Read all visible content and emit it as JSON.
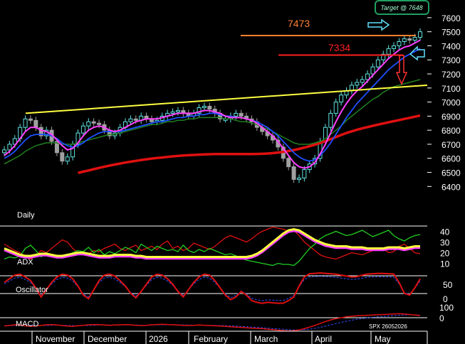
{
  "chart_data": {
    "type": "line",
    "ticker_label": "SPX 26052026",
    "target_badge": "Target @ 7648",
    "levels": [
      {
        "label": "7473",
        "value": 7473,
        "color": "#ff8030"
      },
      {
        "label": "7334",
        "value": 7334,
        "color": "#ff2020"
      }
    ],
    "price_axis": {
      "min": 6250,
      "max": 7660,
      "ticks": [
        7600,
        7500,
        7400,
        7300,
        7200,
        7100,
        7000,
        6900,
        6800,
        6700,
        6600,
        6500,
        6400
      ]
    },
    "months": [
      "November",
      "December",
      "2026",
      "February",
      "March",
      "April",
      "May"
    ],
    "panels": [
      {
        "label": "Daily"
      },
      {
        "label": "ADX",
        "ticks": [
          40,
          30,
          20,
          10
        ],
        "range": [
          5,
          45
        ]
      },
      {
        "label": "Oscillator",
        "ticks": [
          50,
          0
        ],
        "range": [
          -80,
          100
        ]
      },
      {
        "label": "MACD",
        "ticks": [
          100,
          0
        ],
        "range": [
          -60,
          150
        ]
      }
    ],
    "trendline": {
      "x": [
        36,
        600
      ],
      "y": [
        6920,
        7120
      ],
      "color": "#ffff40"
    },
    "colors": {
      "ma_fast": "#ff40ff",
      "ma_mid": "#1e50ff",
      "ma_slow": "#208020",
      "ma_long": "#e01010",
      "adx": "#ffff40",
      "di_plus": "#20d020",
      "di_minus": "#e01010",
      "adx_ma": "#ff40ff",
      "candle_up": "#60e0e0",
      "candle_down": "#a0a0a0",
      "badge": "#20a060"
    },
    "price_series": [
      6660,
      6700,
      6740,
      6820,
      6880,
      6870,
      6820,
      6760,
      6800,
      6720,
      6640,
      6580,
      6610,
      6700,
      6780,
      6830,
      6860,
      6850,
      6840,
      6800,
      6760,
      6780,
      6820,
      6860,
      6880,
      6870,
      6900,
      6880,
      6860,
      6870,
      6900,
      6920,
      6930,
      6940,
      6920,
      6900,
      6920,
      6960,
      6970,
      6950,
      6920,
      6880,
      6880,
      6900,
      6920,
      6900,
      6880,
      6860,
      6820,
      6790,
      6760,
      6730,
      6680,
      6600,
      6540,
      6450,
      6460,
      6520,
      6560,
      6600,
      6720,
      6820,
      6920,
      7000,
      7050,
      7080,
      7120,
      7140,
      7160,
      7200,
      7250,
      7300,
      7340,
      7380,
      7400,
      7430,
      7450,
      7440,
      7460,
      7500
    ],
    "ma_fast_series": [
      6620,
      6650,
      6690,
      6740,
      6790,
      6820,
      6820,
      6800,
      6790,
      6770,
      6730,
      6690,
      6660,
      6670,
      6710,
      6760,
      6800,
      6820,
      6830,
      6820,
      6800,
      6790,
      6800,
      6820,
      6840,
      6860,
      6870,
      6880,
      6880,
      6880,
      6890,
      6900,
      6910,
      6920,
      6920,
      6920,
      6920,
      6930,
      6940,
      6940,
      6930,
      6920,
      6900,
      6890,
      6890,
      6890,
      6880,
      6870,
      6850,
      6820,
      6790,
      6760,
      6720,
      6670,
      6620,
      6570,
      6540,
      6530,
      6540,
      6570,
      6630,
      6700,
      6780,
      6860,
      6930,
      6990,
      7040,
      7080,
      7110,
      7150,
      7190,
      7230,
      7270,
      7310,
      7340,
      7370,
      7390,
      7400,
      7420,
      7440
    ],
    "ma_mid_series": [
      6600,
      6620,
      6650,
      6690,
      6730,
      6760,
      6770,
      6770,
      6770,
      6760,
      6740,
      6710,
      6690,
      6680,
      6690,
      6710,
      6740,
      6760,
      6780,
      6790,
      6790,
      6790,
      6790,
      6800,
      6810,
      6820,
      6830,
      6840,
      6850,
      6860,
      6860,
      6870,
      6880,
      6890,
      6890,
      6900,
      6900,
      6910,
      6910,
      6920,
      6920,
      6910,
      6900,
      6900,
      6890,
      6890,
      6880,
      6870,
      6860,
      6840,
      6820,
      6790,
      6760,
      6720,
      6680,
      6640,
      6610,
      6590,
      6580,
      6590,
      6620,
      6660,
      6710,
      6770,
      6830,
      6890,
      6940,
      6990,
      7030,
      7070,
      7110,
      7150,
      7190,
      7230,
      7260,
      7290,
      7320,
      7340,
      7360,
      7380
    ],
    "ma_slow_series": [
      6560,
      6580,
      6600,
      6620,
      6650,
      6670,
      6690,
      6700,
      6710,
      6710,
      6710,
      6700,
      6700,
      6700,
      6710,
      6720,
      6730,
      6740,
      6750,
      6760,
      6770,
      6770,
      6780,
      6790,
      6800,
      6810,
      6820,
      6830,
      6840,
      6840,
      6850,
      6860,
      6860,
      6870,
      6870,
      6880,
      6880,
      6890,
      6890,
      6890,
      6890,
      6890,
      6880,
      6880,
      6870,
      6860,
      6860,
      6850,
      6840,
      6820,
      6810,
      6790,
      6770,
      6750,
      6730,
      6710,
      6700,
      6700,
      6700,
      6710,
      6720,
      6740,
      6770,
      6800,
      6830,
      6870,
      6900,
      6930,
      6960,
      6990,
      7020,
      7040,
      7070,
      7090,
      7110,
      7120,
      7130,
      7140,
      7150,
      7160
    ],
    "ma_long_series": [
      6340,
      6352,
      6364,
      6376,
      6388,
      6400,
      6412,
      6423,
      6434,
      6445,
      6456,
      6466,
      6476,
      6486,
      6496,
      6505,
      6514,
      6523,
      6532,
      6540,
      6548,
      6556,
      6563,
      6570,
      6576,
      6582,
      6588,
      6593,
      6598,
      6602,
      6606,
      6610,
      6614,
      6617,
      6620,
      6622,
      6624,
      6626,
      6628,
      6629,
      6630,
      6630,
      6630,
      6630,
      6630,
      6630,
      6630,
      6630,
      6631,
      6632,
      6634,
      6637,
      6641,
      6646,
      6652,
      6659,
      6667,
      6676,
      6686,
      6697,
      6709,
      6722,
      6736,
      6751,
      6766,
      6780,
      6792,
      6803,
      6813,
      6822,
      6831,
      6840,
      6848,
      6856,
      6864,
      6872,
      6880,
      6888,
      6896,
      6904
    ],
    "adx_series": [
      24,
      22,
      20,
      18,
      17,
      17,
      18,
      19,
      19,
      18,
      17,
      17,
      18,
      19,
      20,
      20,
      19,
      18,
      17,
      17,
      17,
      18,
      18,
      18,
      18,
      17,
      17,
      16,
      16,
      16,
      16,
      16,
      16,
      16,
      16,
      16,
      16,
      16,
      16,
      16,
      16,
      16,
      16,
      16,
      16,
      16,
      16,
      17,
      19,
      22,
      26,
      30,
      34,
      38,
      41,
      42,
      41,
      38,
      35,
      32,
      30,
      28,
      27,
      26,
      26,
      26,
      25,
      25,
      25,
      24,
      24,
      24,
      24,
      25,
      25,
      25,
      24,
      25,
      26,
      26
    ],
    "di_plus_series": [
      14,
      16,
      15,
      17,
      24,
      27,
      22,
      16,
      20,
      18,
      16,
      15,
      17,
      20,
      22,
      21,
      25,
      20,
      23,
      18,
      21,
      19,
      22,
      25,
      23,
      20,
      28,
      25,
      22,
      26,
      24,
      22,
      23,
      21,
      27,
      22,
      20,
      23,
      21,
      24,
      22,
      20,
      18,
      19,
      17,
      15,
      13,
      12,
      11,
      10,
      9,
      8,
      10,
      9,
      9,
      8,
      12,
      18,
      24,
      28,
      33,
      36,
      38,
      40,
      38,
      36,
      37,
      39,
      41,
      38,
      35,
      37,
      39,
      41,
      36,
      33,
      31,
      34,
      36,
      37
    ],
    "di_minus_series": [
      28,
      25,
      22,
      20,
      16,
      14,
      17,
      22,
      20,
      24,
      28,
      32,
      30,
      24,
      20,
      18,
      19,
      22,
      21,
      24,
      26,
      28,
      24,
      22,
      25,
      27,
      22,
      24,
      26,
      23,
      28,
      31,
      24,
      26,
      22,
      24,
      29,
      27,
      25,
      23,
      26,
      30,
      34,
      36,
      34,
      32,
      30,
      33,
      37,
      40,
      42,
      44,
      43,
      42,
      40,
      41,
      36,
      30,
      26,
      22,
      18,
      16,
      15,
      14,
      16,
      18,
      20,
      19,
      18,
      20,
      22,
      23,
      24,
      20,
      21,
      26,
      28,
      24,
      20,
      19
    ],
    "oscillator_series": [
      40,
      60,
      80,
      85,
      70,
      50,
      10,
      -40,
      0,
      40,
      70,
      85,
      80,
      60,
      20,
      -30,
      -50,
      0,
      50,
      80,
      85,
      75,
      50,
      20,
      -20,
      -45,
      -10,
      30,
      70,
      85,
      80,
      60,
      30,
      -10,
      -40,
      0,
      40,
      70,
      85,
      80,
      50,
      10,
      -30,
      -55,
      -40,
      -10,
      -30,
      -60,
      -70,
      -75,
      -70,
      -72,
      -75,
      -74,
      -60,
      -40,
      20,
      70,
      88,
      90,
      92,
      90,
      88,
      85,
      80,
      75,
      70,
      72,
      80,
      86,
      88,
      90,
      89,
      88,
      86,
      40,
      -20,
      -30,
      10,
      60
    ],
    "macd_series": [
      -20,
      -15,
      -10,
      -12,
      -18,
      -22,
      -20,
      -15,
      -10,
      -8,
      -12,
      -16,
      -20,
      -22,
      -18,
      -14,
      -10,
      -8,
      -9,
      -12,
      -14,
      -12,
      -10,
      -8,
      -10,
      -14,
      -16,
      -14,
      -10,
      -8,
      -6,
      -8,
      -10,
      -12,
      -14,
      -16,
      -14,
      -12,
      -14,
      -16,
      -18,
      -20,
      -22,
      -25,
      -28,
      -30,
      -33,
      -36,
      -38,
      -40,
      -45,
      -48,
      -52,
      -55,
      -58,
      -56,
      -50,
      -40,
      -28,
      -15,
      0,
      15,
      28,
      38,
      45,
      52,
      56,
      60,
      62,
      64,
      66,
      68,
      70,
      72,
      74,
      76,
      74,
      70,
      66,
      62
    ],
    "macd_signal_series": [
      -18,
      -17,
      -15,
      -14,
      -15,
      -16,
      -17,
      -16,
      -15,
      -13,
      -13,
      -14,
      -15,
      -17,
      -17,
      -16,
      -15,
      -13,
      -12,
      -12,
      -12,
      -12,
      -12,
      -11,
      -11,
      -12,
      -13,
      -13,
      -12,
      -11,
      -10,
      -9,
      -9,
      -10,
      -11,
      -12,
      -13,
      -13,
      -13,
      -14,
      -15,
      -16,
      -17,
      -19,
      -21,
      -23,
      -25,
      -28,
      -31,
      -33,
      -36,
      -39,
      -42,
      -45,
      -48,
      -50,
      -50,
      -48,
      -44,
      -38,
      -30,
      -21,
      -11,
      -1,
      9,
      18,
      26,
      33,
      39,
      44,
      48,
      52,
      55,
      58,
      61,
      64,
      66,
      67,
      67,
      66
    ]
  }
}
